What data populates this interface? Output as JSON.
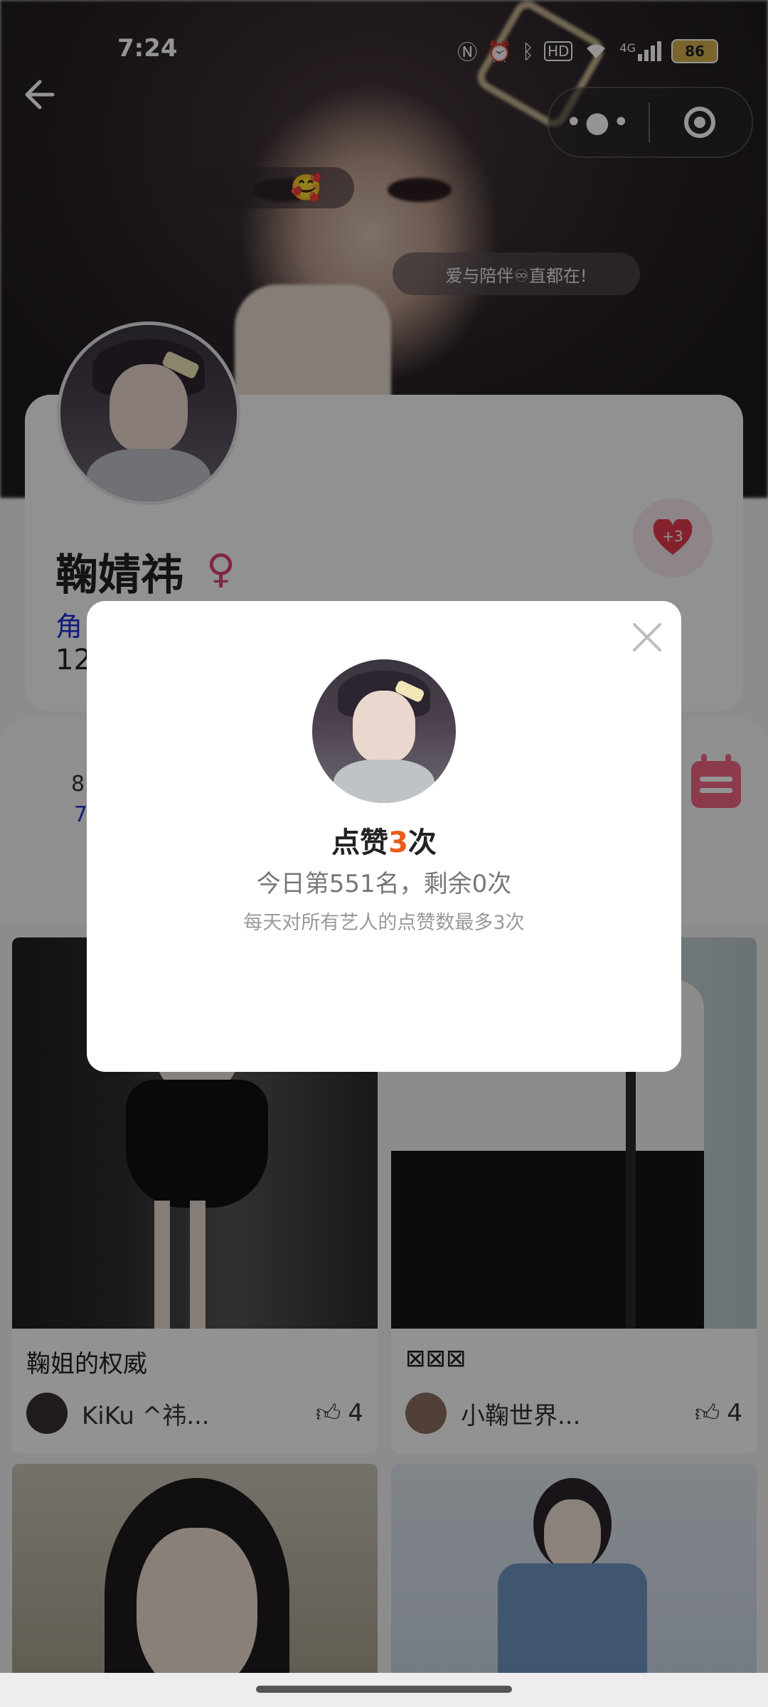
{
  "status_bar": {
    "time": "7:24",
    "icons": [
      "nfc-icon",
      "alarm-icon",
      "bluetooth-icon",
      "hd-icon",
      "wifi-icon",
      "4g-signal-icon"
    ],
    "hd_label": "HD",
    "network_label": "4G",
    "battery": "86"
  },
  "hero": {
    "emoji": "🥰",
    "slogan": "爱与陪伴♾直都在!"
  },
  "profile": {
    "name": "鞠婧祎",
    "gender_symbol": "♀",
    "role_partial": "角",
    "number_partial": "12",
    "like_badge": "+3"
  },
  "stats": {
    "line1_partial": "8",
    "line2_partial": "7"
  },
  "posts": [
    {
      "title": "鞠姐的权威",
      "user": "KiKu ^祎...",
      "likes": "4"
    },
    {
      "title": "⊠⊠⊠",
      "user": "小鞠世界...",
      "likes": "4"
    },
    {
      "title": "",
      "user": "",
      "likes": ""
    },
    {
      "title": "",
      "user": "",
      "likes": ""
    }
  ],
  "dialog": {
    "title_prefix": "点赞",
    "title_count": "3",
    "title_suffix": "次",
    "rank_text": "今日第551名，剩余0次",
    "note": "每天对所有艺人的点赞数最多3次"
  },
  "colors": {
    "accent": "#ea5a1a",
    "link_blue": "#1f2fd6",
    "gender_pink": "#e0407a",
    "heart_red": "#e23b4c",
    "calendar_pink": "#f06682"
  }
}
